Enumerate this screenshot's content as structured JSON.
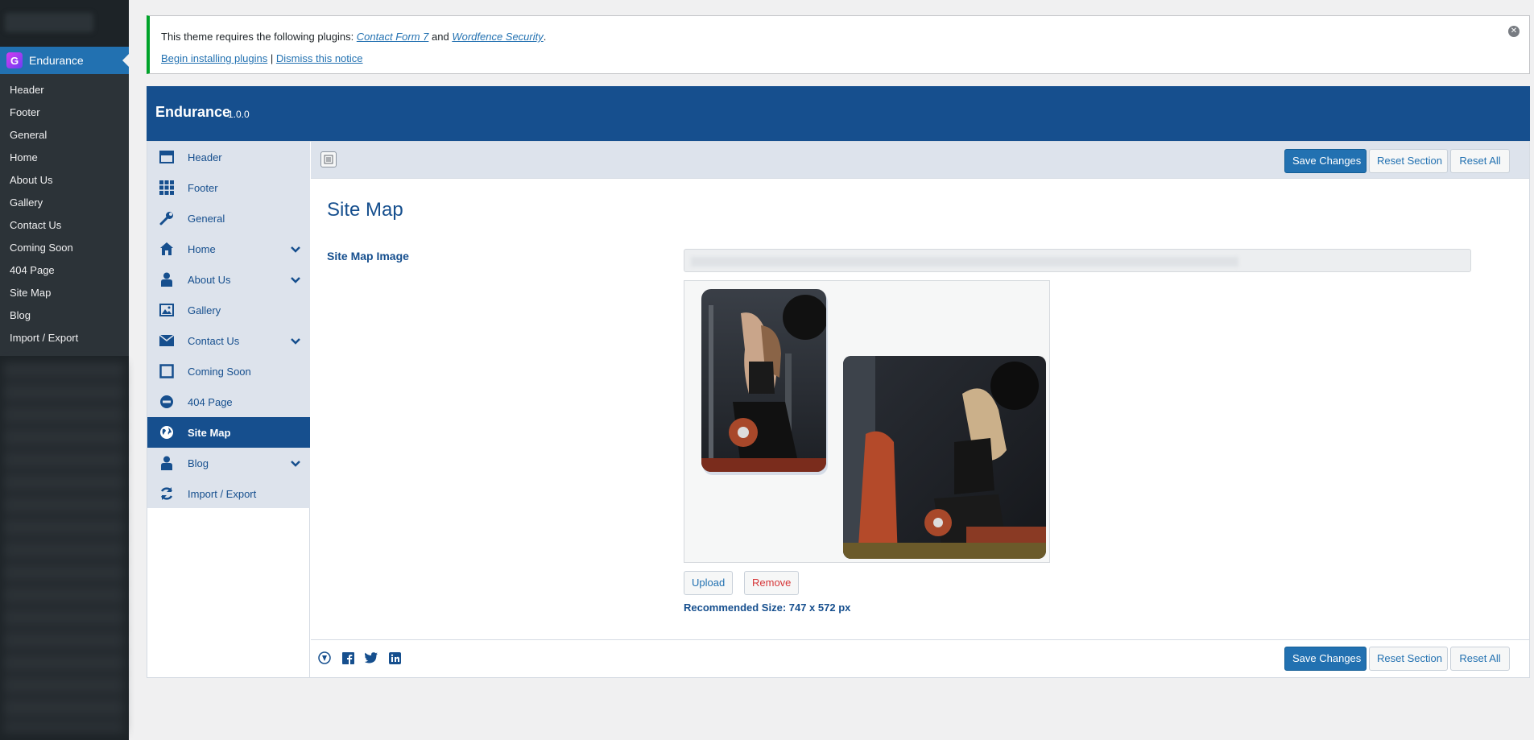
{
  "wp_menu": {
    "current": "Endurance",
    "items": [
      "Header",
      "Footer",
      "General",
      "Home",
      "About Us",
      "Gallery",
      "Contact Us",
      "Coming Soon",
      "404 Page",
      "Site Map",
      "Blog",
      "Import / Export"
    ]
  },
  "notice": {
    "prefix": "This theme requires the following plugins: ",
    "plugin1": "Contact Form 7",
    "and": " and ",
    "plugin2": "Wordfence Security",
    "suffix": ".",
    "begin_link": "Begin installing plugins",
    "separator": " | ",
    "dismiss_link": "Dismiss this notice"
  },
  "panel": {
    "title": "Endurance",
    "version": "1.0.0",
    "nav": [
      {
        "label": "Header",
        "icon": "header-layout-icon",
        "has_children": false
      },
      {
        "label": "Footer",
        "icon": "grid-icon",
        "has_children": false
      },
      {
        "label": "General",
        "icon": "wrench-icon",
        "has_children": false
      },
      {
        "label": "Home",
        "icon": "home-icon",
        "has_children": true
      },
      {
        "label": "About Us",
        "icon": "person-icon",
        "has_children": true
      },
      {
        "label": "Gallery",
        "icon": "image-icon",
        "has_children": false
      },
      {
        "label": "Contact Us",
        "icon": "envelope-icon",
        "has_children": true
      },
      {
        "label": "Coming Soon",
        "icon": "square-icon",
        "has_children": false
      },
      {
        "label": "404 Page",
        "icon": "minus-circle-icon",
        "has_children": false
      },
      {
        "label": "Site Map",
        "icon": "globe-icon",
        "has_children": false,
        "active": true
      },
      {
        "label": "Blog",
        "icon": "person-icon",
        "has_children": true
      },
      {
        "label": "Import / Export",
        "icon": "refresh-icon",
        "has_children": false
      }
    ],
    "buttons": {
      "save": "Save Changes",
      "reset_section": "Reset Section",
      "reset_all": "Reset All"
    }
  },
  "content": {
    "section_title": "Site Map",
    "field_label": "Site Map Image",
    "upload": "Upload",
    "remove": "Remove",
    "recommended": "Recommended Size: 747 x 572 px"
  },
  "footer_icons": [
    "redux-icon",
    "facebook-icon",
    "twitter-icon",
    "linkedin-icon"
  ],
  "colors": {
    "accent": "#164f8e",
    "wp_blue": "#2271b1",
    "success": "#00a32a",
    "danger": "#d63638"
  }
}
